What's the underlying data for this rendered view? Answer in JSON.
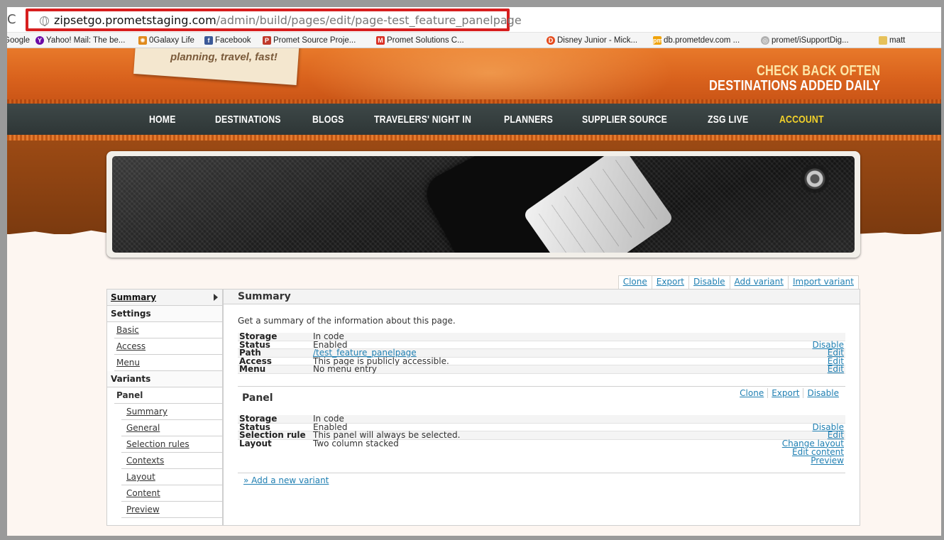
{
  "browser": {
    "reload_glyph": "C",
    "url_host": "zipsetgo.prometstaging.com",
    "url_path": "/admin/build/pages/edit/page-test_feature_panelpage",
    "bookmarks": [
      {
        "label": "Google",
        "icon": "google-icon",
        "color": "#4285f4"
      },
      {
        "label": "Yahoo! Mail: The be...",
        "icon": "yahoo-icon",
        "color": "#6b0aa6"
      },
      {
        "label": "0Galaxy Life",
        "icon": "galaxy-icon",
        "color": "#e08a1c"
      },
      {
        "label": "Facebook",
        "icon": "facebook-icon",
        "color": "#3b5998"
      },
      {
        "label": "Promet Source Proje...",
        "icon": "promet-icon",
        "color": "#c0392b"
      },
      {
        "label": "Promet Solutions C...",
        "icon": "gmail-icon",
        "color": "#d93025"
      },
      {
        "label": "Disney Junior - Mick...",
        "icon": "disney-icon",
        "color": "#e54b1d"
      },
      {
        "label": "db.prometdev.com ...",
        "icon": "phpmyadmin-icon",
        "color": "#f0a30a"
      },
      {
        "label": "promet/iSupportDig...",
        "icon": "globe-icon",
        "color": "#b0b0b0"
      },
      {
        "label": "matt",
        "icon": "folder-icon",
        "color": "#e6c15a"
      }
    ]
  },
  "site": {
    "tagline": "planning, travel, fast!",
    "cta_line1": "CHECK BACK OFTEN",
    "cta_line2": "DESTINATIONS ADDED DAILY",
    "nav": [
      "HOME",
      "DESTINATIONS",
      "BLOGS",
      "TRAVELERS' NIGHT IN",
      "PLANNERS",
      "SUPPLIER SOURCE",
      "ZSG LIVE",
      "ACCOUNT"
    ],
    "nav_active": "ACCOUNT",
    "accent_color": "#f2d12a"
  },
  "tabs": [
    "Clone",
    "Export",
    "Disable",
    "Add variant",
    "Import variant"
  ],
  "sidebar": {
    "summary": "Summary",
    "settings": "Settings",
    "basic": "Basic",
    "access": "Access",
    "menu": "Menu",
    "variants": "Variants",
    "panel": "Panel",
    "panel_items": [
      "Summary",
      "General",
      "Selection rules",
      "Contexts",
      "Layout",
      "Content",
      "Preview"
    ]
  },
  "main": {
    "title": "Summary",
    "description": "Get a summary of the information about this page.",
    "info": [
      {
        "key": "Storage",
        "value": "In code",
        "action": ""
      },
      {
        "key": "Status",
        "value": "Enabled",
        "action": "Disable"
      },
      {
        "key": "Path",
        "value": "/test_feature_panelpage",
        "action": "Edit"
      },
      {
        "key": "Access",
        "value": "This page is publicly accessible.",
        "action": "Edit"
      },
      {
        "key": "Menu",
        "value": "No menu entry",
        "action": "Edit"
      }
    ],
    "variant": {
      "title": "Panel",
      "links": [
        "Clone",
        "Export",
        "Disable"
      ],
      "info": [
        {
          "key": "Storage",
          "value": "In code",
          "action": ""
        },
        {
          "key": "Status",
          "value": "Enabled",
          "action": "Disable"
        },
        {
          "key": "Selection rule",
          "value": "This panel will always be selected.",
          "action": "Edit"
        },
        {
          "key": "Layout",
          "value": "Two column stacked",
          "action": ""
        }
      ],
      "layout_actions": [
        "Change layout",
        "Edit content",
        "Preview"
      ]
    },
    "add_variant": "» Add a new variant"
  }
}
